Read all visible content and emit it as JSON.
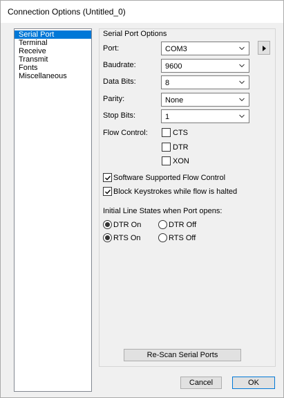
{
  "window": {
    "title": "Connection Options (Untitled_0)"
  },
  "sidebar": {
    "items": [
      {
        "label": "Serial Port",
        "selected": true
      },
      {
        "label": "Terminal",
        "selected": false
      },
      {
        "label": "Receive",
        "selected": false
      },
      {
        "label": "Transmit",
        "selected": false
      },
      {
        "label": "Fonts",
        "selected": false
      },
      {
        "label": "Miscellaneous",
        "selected": false
      }
    ]
  },
  "serial_port": {
    "group_title": "Serial Port Options",
    "port": {
      "label": "Port:",
      "value": "COM3"
    },
    "baudrate": {
      "label": "Baudrate:",
      "value": "9600"
    },
    "data_bits": {
      "label": "Data Bits:",
      "value": "8"
    },
    "parity": {
      "label": "Parity:",
      "value": "None"
    },
    "stop_bits": {
      "label": "Stop Bits:",
      "value": "1"
    },
    "flow_control": {
      "label": "Flow Control:",
      "cts": {
        "label": "CTS",
        "checked": false
      },
      "dtr": {
        "label": "DTR",
        "checked": false
      },
      "xon": {
        "label": "XON",
        "checked": false
      }
    },
    "software_flow": {
      "label": "Software Supported Flow Control",
      "checked": true
    },
    "block_keystrokes": {
      "label": "Block Keystrokes while flow is halted",
      "checked": true
    },
    "line_states": {
      "label": "Initial Line States when Port opens:",
      "dtr_on": {
        "label": "DTR On",
        "selected": true
      },
      "dtr_off": {
        "label": "DTR Off",
        "selected": false
      },
      "rts_on": {
        "label": "RTS On",
        "selected": true
      },
      "rts_off": {
        "label": "RTS Off",
        "selected": false
      }
    },
    "rescan_label": "Re-Scan Serial Ports"
  },
  "footer": {
    "cancel_label": "Cancel",
    "ok_label": "OK"
  },
  "colors": {
    "selection": "#0078d7",
    "background": "#f0f0f0"
  }
}
